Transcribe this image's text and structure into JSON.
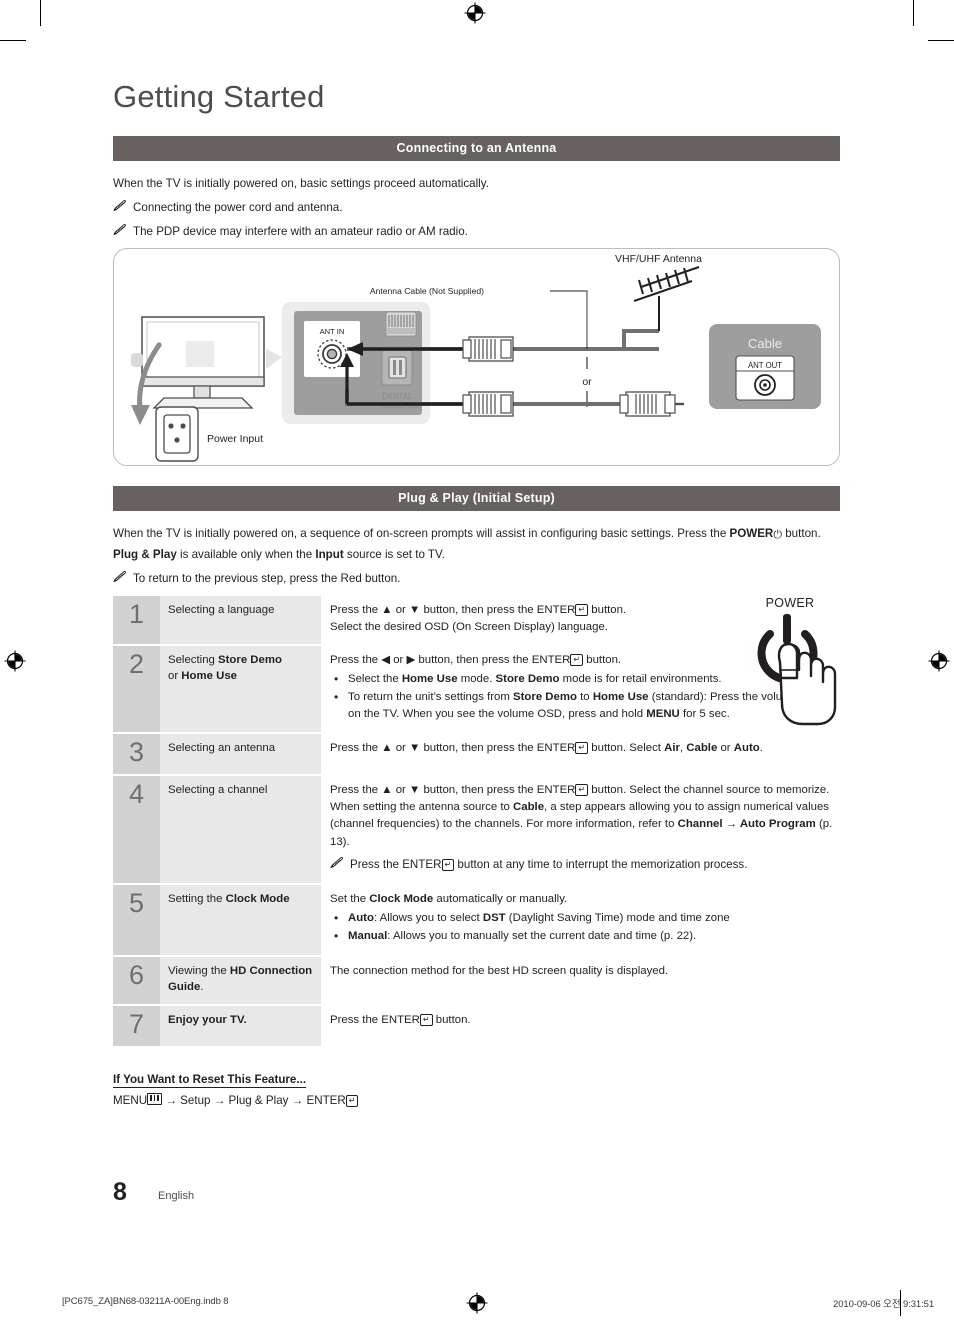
{
  "page": {
    "title": "Getting Started",
    "number": "8",
    "language_label": "English"
  },
  "sections": {
    "antenna": {
      "heading": "Connecting to an Antenna",
      "intro": "When the TV is initially powered on, basic settings proceed automatically.",
      "notes": [
        "Connecting the power cord and antenna.",
        "The PDP device may interfere with an amateur radio or AM radio."
      ],
      "diagram": {
        "labels": {
          "vhf_uhf_antenna": "VHF/UHF Antenna",
          "antenna_cable": "Antenna Cable (Not Supplied)",
          "or": "or",
          "ant_in": "ANT IN",
          "ant_out": "ANT OUT",
          "cable": "Cable",
          "power_input": "Power Input",
          "digital_audio_out_line1": "DIGITAL",
          "digital_audio_out_line2": "AUDIO OUT"
        }
      }
    },
    "plug_and_play": {
      "heading": "Plug & Play (Initial Setup)",
      "intro_part1": "When the TV is initially powered on, a sequence of on-screen prompts will assist in configuring basic settings. Press the ",
      "intro_power": "POWER",
      "intro_part2": " button. ",
      "intro_pp": "Plug & Play",
      "intro_part3": " is available only when the ",
      "intro_input": "Input",
      "intro_part4": " source is set to TV.",
      "note": "To return to the previous step, press the Red button.",
      "power_illustration_label": "POWER",
      "steps": [
        {
          "number": "1",
          "label_plain": "Selecting a language",
          "desc_line1_a": "Press the ▲ or ▼ button, then press the ENTER",
          "desc_line1_b": " button.",
          "desc_line2": "Select the desired OSD (On Screen Display) language."
        },
        {
          "number": "2",
          "label_a": "Selecting ",
          "label_b": "Store Demo",
          "label_c": "or ",
          "label_d": "Home Use",
          "desc_intro_a": "Press the ◀ or ▶ button, then press the ENTER",
          "desc_intro_b": " button.",
          "bullet1_a": "Select the ",
          "bullet1_b": "Home Use",
          "bullet1_c": " mode. ",
          "bullet1_d": "Store Demo",
          "bullet1_e": " mode is for retail environments.",
          "bullet2_a": "To return the unit’s settings from ",
          "bullet2_b": "Store Demo",
          "bullet2_c": " to ",
          "bullet2_d": "Home Use",
          "bullet2_e": " (standard): Press the volume button on the TV. When you see the volume OSD, press and hold ",
          "bullet2_f": "MENU",
          "bullet2_g": " for 5 sec."
        },
        {
          "number": "3",
          "label_plain": "Selecting an antenna",
          "desc_a": "Press the ▲ or ▼ button, then press the ENTER",
          "desc_b": " button. Select ",
          "desc_air": "Air",
          "desc_c": ", ",
          "desc_cable": "Cable",
          "desc_d": " or ",
          "desc_auto": "Auto",
          "desc_e": "."
        },
        {
          "number": "4",
          "label_plain": "Selecting a channel",
          "desc_a": "Press the ▲ or ▼ button, then press the ENTER",
          "desc_b": " button. Select the channel source to memorize. When setting the antenna source to ",
          "desc_cable": "Cable",
          "desc_c": ", a step appears allowing you to assign numerical values (channel frequencies) to the channels. For more information, refer to ",
          "desc_channel": "Channel → Auto Program",
          "desc_d": " (p. 13).",
          "note_a": "Press the ENTER",
          "note_b": " button at any time to interrupt the memorization process."
        },
        {
          "number": "5",
          "label_a": "Setting the ",
          "label_b": "Clock Mode",
          "desc_a": "Set the ",
          "desc_b": "Clock Mode",
          "desc_c": " automatically or manually.",
          "bullet1_b": "Auto",
          "bullet1_c": ": Allows you to select ",
          "bullet1_d": "DST",
          "bullet1_e": " (Daylight Saving Time) mode and time zone",
          "bullet2_b": "Manual",
          "bullet2_c": ": Allows you to manually set the current date and time (p. 22)."
        },
        {
          "number": "6",
          "label_a": "Viewing the ",
          "label_b": "HD Connection Guide",
          "label_c": ".",
          "desc_plain": "The connection method for the best HD screen quality is displayed."
        },
        {
          "number": "7",
          "label_bold": "Enjoy your TV.",
          "desc_a": "Press the ENTER",
          "desc_b": " button."
        }
      ],
      "reset": {
        "title": "If You Want to Reset This Feature...",
        "path_menu": "MENU",
        "path_rest": " → Setup → Plug & Play → ENTER"
      }
    }
  },
  "print_footer": {
    "file": "[PC675_ZA]BN68-03211A-00Eng.indb   8",
    "timestamp": "2010-09-06   오전 9:31:51"
  },
  "colors": {
    "section_bar": "#67625f",
    "step_number_cell": "#d2d2d2",
    "step_label_cell": "#e8e8e8",
    "title_gray": "#4d4d4f",
    "body_text": "#231f20"
  }
}
